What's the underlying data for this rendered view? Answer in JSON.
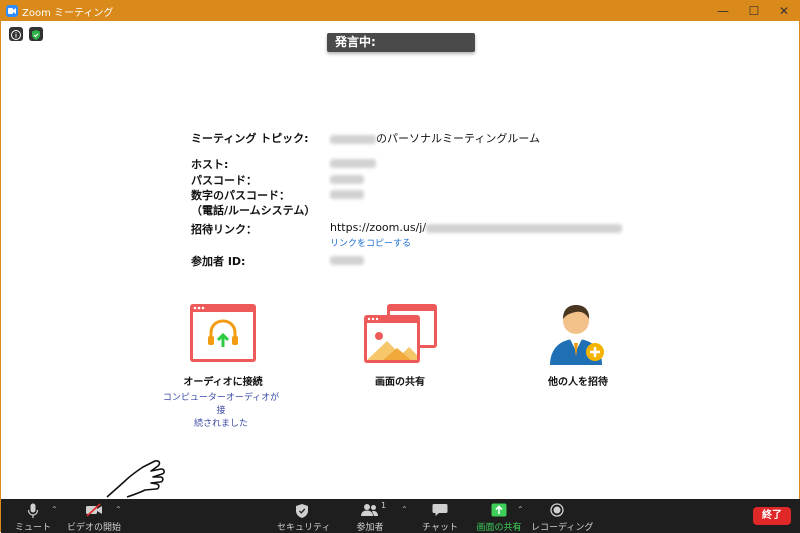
{
  "window": {
    "title": "Zoom ミーティング"
  },
  "speaking_banner": "発言中:",
  "details": {
    "topic_label": "ミーティング トピック:",
    "topic_suffix": "のパーソナルミーティングルーム",
    "host_label": "ホスト:",
    "passcode_label": "パスコード：",
    "numeric_passcode_label": "数字のパスコード：",
    "numeric_passcode_sub": "（電話/ルームシステム）",
    "invite_label": "招待リンク：",
    "invite_url_prefix": "https://zoom.us/j/",
    "copy_link": "リンクをコピーする",
    "participant_id_label": "参加者 ID:"
  },
  "actions": {
    "audio": {
      "label": "オーディオに接続",
      "status_line1": "コンピューターオーディオが接",
      "status_line2": "続されました",
      "icon": "headset-icon"
    },
    "share": {
      "label": "画面の共有",
      "icon": "share-screen-icon"
    },
    "invite": {
      "label": "他の人を招待",
      "icon": "invite-person-icon"
    }
  },
  "toolbar": {
    "mute": "ミュート",
    "video": "ビデオの開始",
    "security": "セキュリティ",
    "participants": "参加者",
    "participants_count": "1",
    "chat": "チャット",
    "share": "画面の共有",
    "record": "レコーディング",
    "end": "終了"
  },
  "colors": {
    "titlebar": "#d98a1a",
    "tile_red": "#ee5a5a",
    "share_green": "#3ecf5b",
    "end_red": "#e02828",
    "link_blue": "#1a6fd6"
  }
}
